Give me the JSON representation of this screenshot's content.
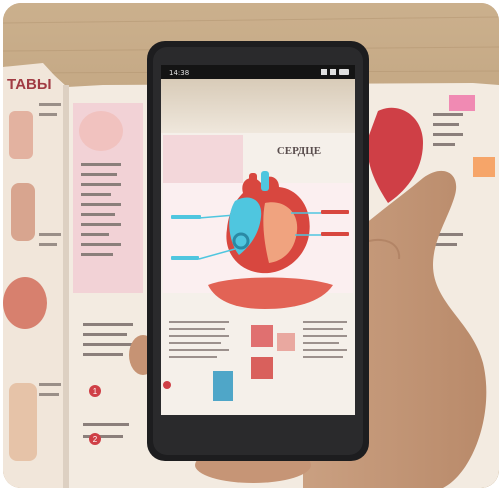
{
  "photo": {
    "book_header_text": "ТАВЫ",
    "screen_heading": "СЕРДЦЕ",
    "status_time": "14:38",
    "status_icons": [
      "signal-icon",
      "wifi-icon",
      "battery-icon"
    ],
    "number_badges": [
      "1",
      "2"
    ],
    "colors": {
      "table_wood": "#b99a74",
      "book_page": "#f4ece3",
      "phone_body": "#1d1d1f",
      "heart_red": "#cf3f46",
      "ar_cyan": "#4fc6df",
      "skin": "#c99877"
    }
  }
}
